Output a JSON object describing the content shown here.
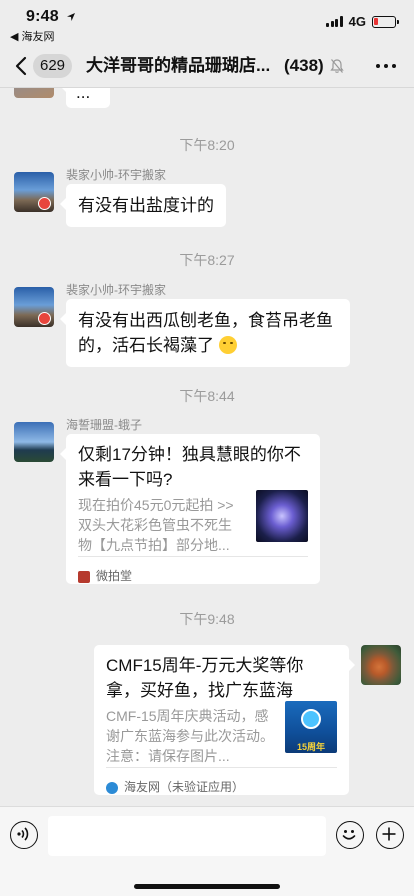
{
  "status_bar": {
    "time": "9:48",
    "back_app": "◀ 海友网",
    "network": "4G"
  },
  "nav": {
    "badge_count": "629",
    "title": "大洋哥哥的精品珊瑚店...",
    "member_count": "(438)"
  },
  "messages": {
    "top_cut_text": "...",
    "ts1": "下午8:20",
    "m1_sender": "裴家小帅-环宇搬家",
    "m1_text": "有没有出盐度计的",
    "ts2": "下午8:27",
    "m2_sender": "裴家小帅-环宇搬家",
    "m2_line1": "有没有出西瓜刨老鱼，食苔吊老鱼",
    "m2_line2": "的，活石长褐藻了",
    "ts3": "下午8:44",
    "m3_sender": "海誓珊盟-蛾子",
    "m3_card_title": "仅剩17分钟！独具慧眼的你不来看一下吗?",
    "m3_card_desc": "现在拍价45元0元起拍 >> 双头大花彩色管虫不死生物【九点节拍】部分地...",
    "m3_card_source": "微拍堂",
    "ts4": "下午9:48",
    "m4_card_title": "CMF15周年-万元大奖等你拿，买好鱼，找广东蓝海",
    "m4_card_desc": "CMF-15周年庆典活动，感谢广东蓝海参与此次活动。注意：请保存图片...",
    "m4_card_source": "海友网（未验证应用）",
    "m4_thumb_text": "15周年"
  },
  "input": {
    "placeholder": ""
  },
  "colors": {
    "background": "#ededed",
    "bubble": "#ffffff",
    "timestamp": "#9b9b9b",
    "battery_low": "#e83434"
  },
  "icons": [
    "back-chevron-icon",
    "mute-bell-icon",
    "more-icon",
    "voice-icon",
    "emoji-icon",
    "plus-icon"
  ]
}
